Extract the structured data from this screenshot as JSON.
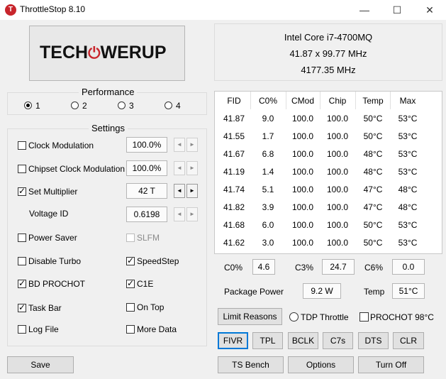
{
  "window": {
    "title": "ThrottleStop 8.10",
    "app_icon_letter": "T"
  },
  "logo": {
    "part1": "TECH",
    "power_symbol": "⏻",
    "part2": "WERUP"
  },
  "cpu": {
    "name": "Intel Core i7-4700MQ",
    "multiplier": "41.87 x 99.77 MHz",
    "speed": "4177.35 MHz"
  },
  "performance": {
    "label": "Performance",
    "profiles": [
      "1",
      "2",
      "3",
      "4"
    ],
    "selected": "1"
  },
  "settings": {
    "label": "Settings",
    "clock_modulation": {
      "label": "Clock Modulation",
      "value": "100.0%"
    },
    "chipset_clock_modulation": {
      "label": "Chipset Clock Modulation",
      "value": "100.0%"
    },
    "set_multiplier": {
      "label": "Set Multiplier",
      "value": "42 T"
    },
    "voltage_id": {
      "label": "Voltage ID",
      "value": "0.6198"
    },
    "power_saver": "Power Saver",
    "slfm": "SLFM",
    "disable_turbo": "Disable Turbo",
    "speedstep": "SpeedStep",
    "bd_prochot": "BD PROCHOT",
    "c1e": "C1E",
    "task_bar": "Task Bar",
    "on_top": "On Top",
    "log_file": "Log File",
    "more_data": "More Data"
  },
  "table": {
    "headers": [
      "FID",
      "C0%",
      "CMod",
      "Chip",
      "Temp",
      "Max"
    ],
    "rows": [
      [
        "41.87",
        "9.0",
        "100.0",
        "100.0",
        "50°C",
        "53°C"
      ],
      [
        "41.55",
        "1.7",
        "100.0",
        "100.0",
        "50°C",
        "53°C"
      ],
      [
        "41.67",
        "6.8",
        "100.0",
        "100.0",
        "48°C",
        "53°C"
      ],
      [
        "41.19",
        "1.4",
        "100.0",
        "100.0",
        "48°C",
        "53°C"
      ],
      [
        "41.74",
        "5.1",
        "100.0",
        "100.0",
        "47°C",
        "48°C"
      ],
      [
        "41.82",
        "3.9",
        "100.0",
        "100.0",
        "47°C",
        "48°C"
      ],
      [
        "41.68",
        "6.0",
        "100.0",
        "100.0",
        "50°C",
        "53°C"
      ],
      [
        "41.62",
        "3.0",
        "100.0",
        "100.0",
        "50°C",
        "53°C"
      ]
    ]
  },
  "summary": {
    "c0_label": "C0%",
    "c0_value": "4.6",
    "c3_label": "C3%",
    "c3_value": "24.7",
    "c6_label": "C6%",
    "c6_value": "0.0",
    "package_power_label": "Package Power",
    "package_power_value": "9.2 W",
    "temp_label": "Temp",
    "temp_value": "51°C"
  },
  "buttons": {
    "limit_reasons": "Limit Reasons",
    "tdp_throttle": "TDP Throttle",
    "prochot": "PROCHOT 98°C",
    "fivr": "FIVR",
    "tpl": "TPL",
    "bclk": "BCLK",
    "c7s": "C7s",
    "dts": "DTS",
    "clr": "CLR",
    "save": "Save",
    "ts_bench": "TS Bench",
    "options": "Options",
    "turn_off": "Turn Off"
  },
  "arrows": {
    "left": "◄",
    "right": "►"
  },
  "window_controls": {
    "minimize": "—",
    "maximize": "☐",
    "close": "✕"
  }
}
